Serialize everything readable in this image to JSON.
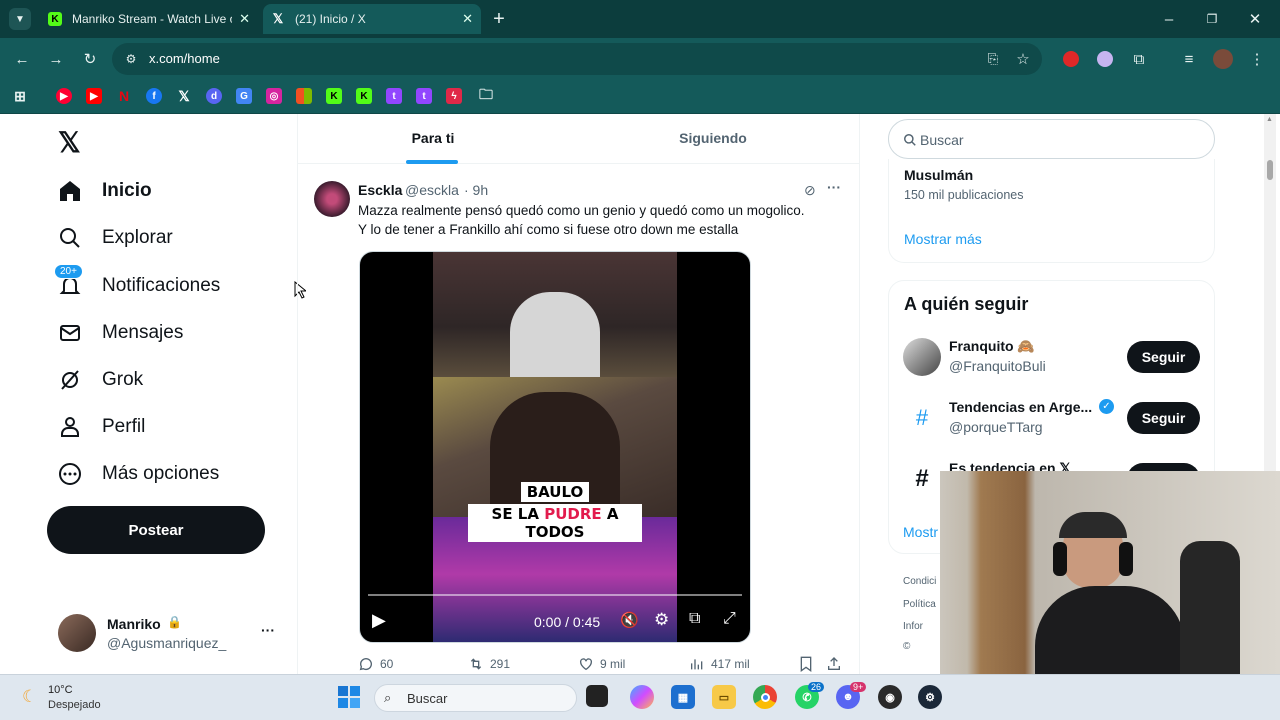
{
  "browser": {
    "tabs": [
      {
        "title": "Manriko Stream - Watch Live or",
        "favicon": "kick-icon"
      },
      {
        "title": "(21) Inicio / X",
        "favicon": "x-icon"
      }
    ],
    "new_tab": "+",
    "url": "x.com/home",
    "window_controls": {
      "minimize": "–",
      "maximize": "❐",
      "close": "✕"
    }
  },
  "sidebar": {
    "items": [
      {
        "label": "Inicio",
        "icon": "home-icon"
      },
      {
        "label": "Explorar",
        "icon": "search-icon"
      },
      {
        "label": "Notificaciones",
        "icon": "bell-icon",
        "badge": "20+"
      },
      {
        "label": "Mensajes",
        "icon": "mail-icon"
      },
      {
        "label": "Grok",
        "icon": "grok-icon"
      },
      {
        "label": "Perfil",
        "icon": "person-icon"
      },
      {
        "label": "Más opciones",
        "icon": "more-circle-icon"
      }
    ],
    "post_button": "Postear",
    "account": {
      "name": "Manriko",
      "handle": "@Agusmanriquez_",
      "more": "···"
    }
  },
  "timeline": {
    "tabs": [
      {
        "label": "Para ti",
        "active": true
      },
      {
        "label": "Siguiendo",
        "active": false
      }
    ],
    "tweet": {
      "author": "Esckla",
      "handle": "@esckla",
      "time": "· 9h",
      "text_line1": "Mazza realmente pensó quedó como un genio y quedó como un mogolico.",
      "text_line2": "Y lo de tener a Frankillo ahí como si fuese otro down me estalla",
      "video": {
        "caption_line1": "BAULO",
        "caption_pre": "SE LA ",
        "caption_highlight": "PUDRE",
        "caption_post": " A TODOS",
        "time": "0:00 / 0:45",
        "progress": 0
      },
      "stats": {
        "replies": "60",
        "retweets": "291",
        "likes": "9 mil",
        "views": "417 mil"
      }
    }
  },
  "right": {
    "search_placeholder": "Buscar",
    "trend": {
      "name": "Musulmán",
      "count": "150 mil publicaciones",
      "show_more": "Mostrar más"
    },
    "who_to_follow": {
      "title": "A quién seguir",
      "accounts": [
        {
          "name": "Franquito 🙈",
          "handle": "@FranquitoBuli",
          "button": "Seguir"
        },
        {
          "name": "Tendencias en Arge...",
          "handle": "@porqueTTarg",
          "button": "Seguir"
        },
        {
          "name": "Es tendencia en 𝕏",
          "handle": "",
          "button": "Seguir"
        }
      ],
      "show_more": "Mostr"
    },
    "footer": [
      "Condici",
      "Política",
      "Infor",
      "©"
    ]
  },
  "taskbar": {
    "weather_temp": "10°C",
    "weather_desc": "Despejado",
    "search": "Buscar",
    "badges": {
      "whatsapp": "26",
      "discord": "9+"
    }
  },
  "colors": {
    "accent": "#1d9bf0",
    "chrome_dark": "#0c3d3d",
    "chrome": "#145a5a",
    "text": "#0f1419",
    "muted": "#536471"
  }
}
